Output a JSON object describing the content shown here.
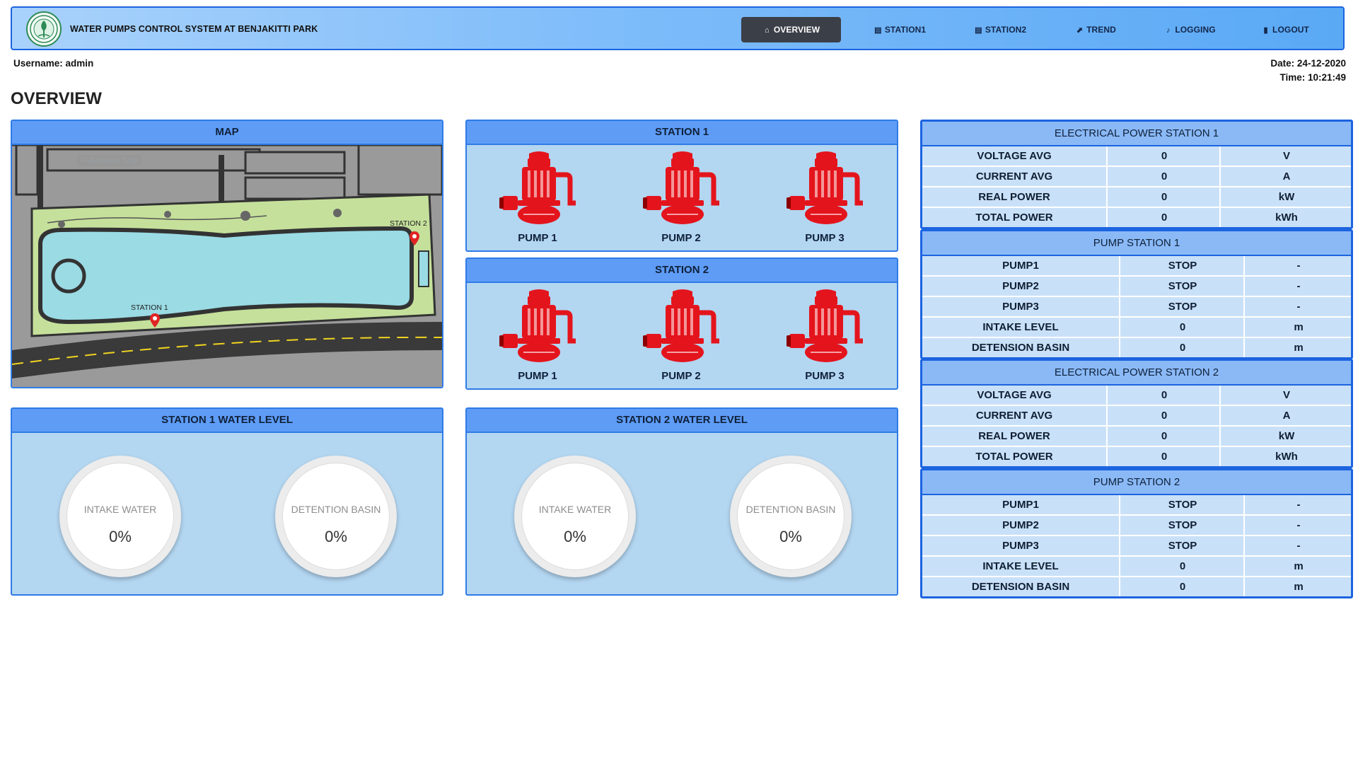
{
  "app": {
    "title": "WATER PUMPS CONTROL SYSTEM AT BENJAKITTI PARK"
  },
  "nav": [
    {
      "label": "OVERVIEW",
      "icon": "home-icon",
      "active": true
    },
    {
      "label": "STATION1",
      "icon": "list-icon"
    },
    {
      "label": "STATION2",
      "icon": "list-icon"
    },
    {
      "label": "TREND",
      "icon": "chart-line-icon"
    },
    {
      "label": "LOGGING",
      "icon": "bell-icon"
    },
    {
      "label": "LOGOUT",
      "icon": "door-icon"
    }
  ],
  "session": {
    "username": "Username: admin",
    "date": "Date: 24-12-2020",
    "time": "Time: 10:21:49"
  },
  "page_title": "OVERVIEW",
  "map": {
    "title": "MAP",
    "hint": "Full-screen Snip",
    "station1_label": "STATION 1",
    "station2_label": "STATION 2"
  },
  "station1": {
    "title": "STATION 1",
    "pumps": [
      "PUMP 1",
      "PUMP 2",
      "PUMP 3"
    ]
  },
  "station2": {
    "title": "STATION 2",
    "pumps": [
      "PUMP 1",
      "PUMP 2",
      "PUMP 3"
    ]
  },
  "level1": {
    "title": "STATION 1 WATER LEVEL",
    "gauges": [
      {
        "label": "INTAKE WATER",
        "value": "0%"
      },
      {
        "label": "DETENTION BASIN",
        "value": "0%"
      }
    ]
  },
  "level2": {
    "title": "STATION 2 WATER LEVEL",
    "gauges": [
      {
        "label": "INTAKE WATER",
        "value": "0%"
      },
      {
        "label": "DETENTION BASIN",
        "value": "0%"
      }
    ]
  },
  "elec1": {
    "title": "ELECTRICAL POWER STATION 1",
    "rows": [
      {
        "name": "VOLTAGE AVG",
        "value": "0",
        "unit": "V"
      },
      {
        "name": "CURRENT AVG",
        "value": "0",
        "unit": "A"
      },
      {
        "name": "REAL POWER",
        "value": "0",
        "unit": "kW"
      },
      {
        "name": "TOTAL POWER",
        "value": "0",
        "unit": "kWh"
      }
    ]
  },
  "pumps1": {
    "title": "PUMP STATION 1",
    "rows": [
      {
        "name": "PUMP1",
        "value": "STOP",
        "unit": "-"
      },
      {
        "name": "PUMP2",
        "value": "STOP",
        "unit": "-"
      },
      {
        "name": "PUMP3",
        "value": "STOP",
        "unit": "-"
      },
      {
        "name": "INTAKE LEVEL",
        "value": "0",
        "unit": "m"
      },
      {
        "name": "DETENSION BASIN",
        "value": "0",
        "unit": "m"
      }
    ]
  },
  "elec2": {
    "title": "ELECTRICAL POWER STATION 2",
    "rows": [
      {
        "name": "VOLTAGE AVG",
        "value": "0",
        "unit": "V"
      },
      {
        "name": "CURRENT AVG",
        "value": "0",
        "unit": "A"
      },
      {
        "name": "REAL POWER",
        "value": "0",
        "unit": "kW"
      },
      {
        "name": "TOTAL POWER",
        "value": "0",
        "unit": "kWh"
      }
    ]
  },
  "pumps2": {
    "title": "PUMP STATION 2",
    "rows": [
      {
        "name": "PUMP1",
        "value": "STOP",
        "unit": "-"
      },
      {
        "name": "PUMP2",
        "value": "STOP",
        "unit": "-"
      },
      {
        "name": "PUMP3",
        "value": "STOP",
        "unit": "-"
      },
      {
        "name": "INTAKE LEVEL",
        "value": "0",
        "unit": "m"
      },
      {
        "name": "DETENSION BASIN",
        "value": "0",
        "unit": "m"
      }
    ]
  },
  "colors": {
    "pump_stopped": "#e4141c",
    "panel_header": "#5e9cf6",
    "panel_body": "#b3d6f1",
    "nav_active": "#3b3f47"
  }
}
